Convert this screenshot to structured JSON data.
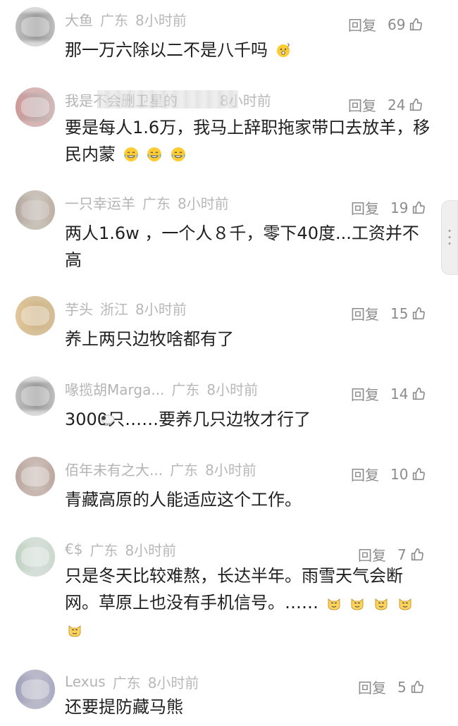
{
  "comments": [
    {
      "name": "大鱼",
      "region": "广东",
      "time": "8小时前",
      "reply": "回复",
      "likes": "69",
      "text": "那一万六除以二不是八千吗"
    },
    {
      "name": "我是不会删卫星的",
      "region": "",
      "time": "8小时前",
      "reply": "回复",
      "likes": "24",
      "text": "要是每人1.6万，我马上辞职拖家带口去放羊，移民内蒙"
    },
    {
      "name": "一只幸运羊",
      "region": "广东",
      "time": "8小时前",
      "reply": "回复",
      "likes": "19",
      "text": "两人1.6w ，一个人８千，零下40度...工资并不高"
    },
    {
      "name": "芋头",
      "region": "浙江",
      "time": "8小时前",
      "reply": "回复",
      "likes": "15",
      "text": "养上两只边牧啥都有了"
    },
    {
      "name": "喙揽胡Marga...",
      "region": "广东",
      "time": "8小时前",
      "reply": "回复",
      "likes": "14",
      "text": "3000只……要养几只边牧才行了"
    },
    {
      "name": "佰年未有之大...",
      "region": "广东",
      "time": "8小时前",
      "reply": "回复",
      "likes": "10",
      "text": "青藏高原的人能适应这个工作。"
    },
    {
      "name": "€$",
      "region": "广东",
      "time": "8小时前",
      "reply": "回复",
      "likes": "7",
      "text": "只是冬天比较难熬，长达半年。雨雪天气会断网。草原上也没有手机信号。……"
    },
    {
      "name": "Lexus",
      "region": "广东",
      "time": "8小时前",
      "reply": "回复",
      "likes": "5",
      "text": "还要提防藏马熊"
    }
  ],
  "icons": {
    "like": "thumbs-up-icon",
    "emoji_1": "shocked-face-icon",
    "emoji_2": "laughing-face-icon",
    "emoji_3": "sheep-icon",
    "emoji_4": "cat-face-icon",
    "scrollbar": "scroll-handle"
  },
  "colors": {
    "meta_text": "#b4b4b4",
    "reply_text": "#8c8c8c",
    "content_text": "#1f1f1f"
  }
}
